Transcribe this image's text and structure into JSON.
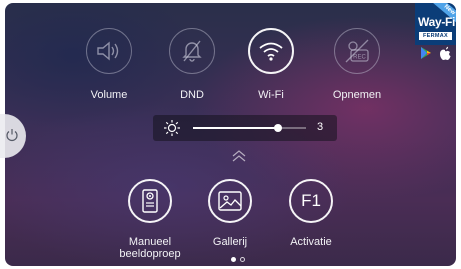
{
  "quick_toggles": [
    {
      "label": "Volume",
      "icon": "speaker-icon",
      "state": "off"
    },
    {
      "label": "DND",
      "icon": "bell-off-icon",
      "state": "off"
    },
    {
      "label": "Wi-Fi",
      "icon": "wifi-icon",
      "state": "on"
    },
    {
      "label": "Opnemen",
      "icon": "record-off-icon",
      "state": "off"
    }
  ],
  "brightness": {
    "icon": "sun-icon",
    "value": "3",
    "level_fraction": 0.75
  },
  "actions": [
    {
      "label_line1": "Manueel",
      "label_line2": "beeldoproep",
      "icon": "door-panel-icon"
    },
    {
      "label_line1": "Gallerij",
      "icon": "image-icon"
    },
    {
      "label_line1": "Activatie",
      "icon_text": "F1"
    }
  ],
  "pager": {
    "pages": 2,
    "current": 1
  },
  "badge": {
    "new_label": "New",
    "brand": "Way-Fi",
    "maker": "FERMAX"
  },
  "colors": {
    "badge_bg": "#0b3d78",
    "badge_ribbon": "#4fa3e8"
  }
}
